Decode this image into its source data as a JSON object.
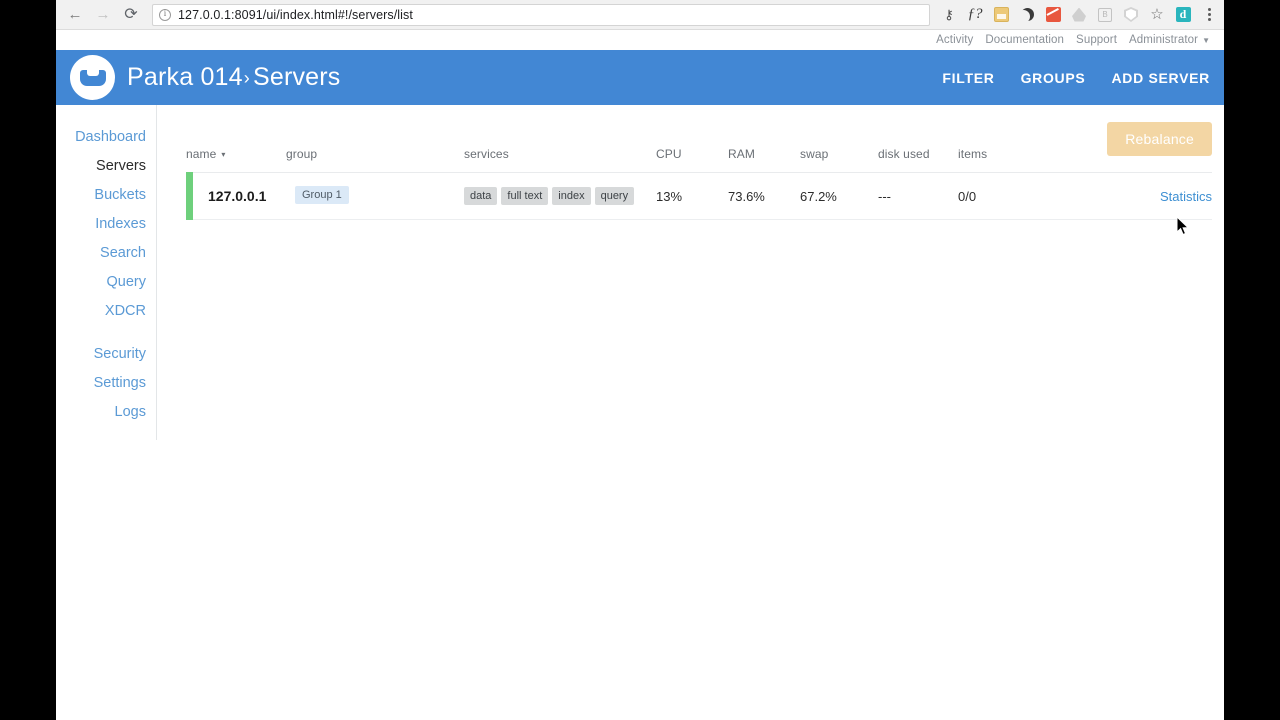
{
  "browser": {
    "back_icon": "back-arrow-icon",
    "forward_icon": "forward-arrow-icon",
    "reload_icon": "reload-icon",
    "url": "127.0.0.1:8091/ui/index.html#!/servers/list",
    "url_host": "127.0.0.1",
    "url_port": ":8091",
    "url_path": "/ui/index.html#!/servers/list",
    "toolbar_icons": [
      "key-icon",
      "f-question-icon",
      "tan-note-icon",
      "dark-mode-moon-icon",
      "chart-icon",
      "cloud-drive-icon",
      "b-box-icon",
      "shield-icon",
      "bookmark-star-icon",
      "d-extension-icon",
      "menu-kebab-icon"
    ]
  },
  "topnav": {
    "links": [
      "Activity",
      "Documentation",
      "Support",
      "Administrator"
    ],
    "caret": "▼"
  },
  "header": {
    "logo": "couchbase-logo-icon",
    "cluster": "Parka 014",
    "separator": "›",
    "section": "Servers",
    "actions": [
      "FILTER",
      "GROUPS",
      "ADD SERVER"
    ],
    "bg_color": "#4287d4"
  },
  "sidebar": {
    "items": [
      {
        "label": "Dashboard",
        "active": false
      },
      {
        "label": "Servers",
        "active": true
      },
      {
        "label": "Buckets",
        "active": false
      },
      {
        "label": "Indexes",
        "active": false
      },
      {
        "label": "Search",
        "active": false
      },
      {
        "label": "Query",
        "active": false
      },
      {
        "label": "XDCR",
        "active": false
      }
    ],
    "items_secondary": [
      {
        "label": "Security",
        "active": false
      },
      {
        "label": "Settings",
        "active": false
      },
      {
        "label": "Logs",
        "active": false
      }
    ],
    "link_color": "#5b9ad5"
  },
  "content": {
    "rebalance_label": "Rebalance",
    "rebalance_color": "#f3d6a4",
    "table": {
      "columns": [
        "name",
        "group",
        "services",
        "CPU",
        "RAM",
        "swap",
        "disk used",
        "items",
        ""
      ],
      "sort_column": "name",
      "sort_caret": "▾",
      "rows": [
        {
          "status_color": "#6ed07c",
          "name": "127.0.0.1",
          "group": "Group 1",
          "services": [
            "data",
            "full text",
            "index",
            "query"
          ],
          "cpu": "13%",
          "ram": "73.6%",
          "swap": "67.2%",
          "disk_used": "---",
          "items": "0/0",
          "action": "Statistics"
        }
      ]
    }
  }
}
